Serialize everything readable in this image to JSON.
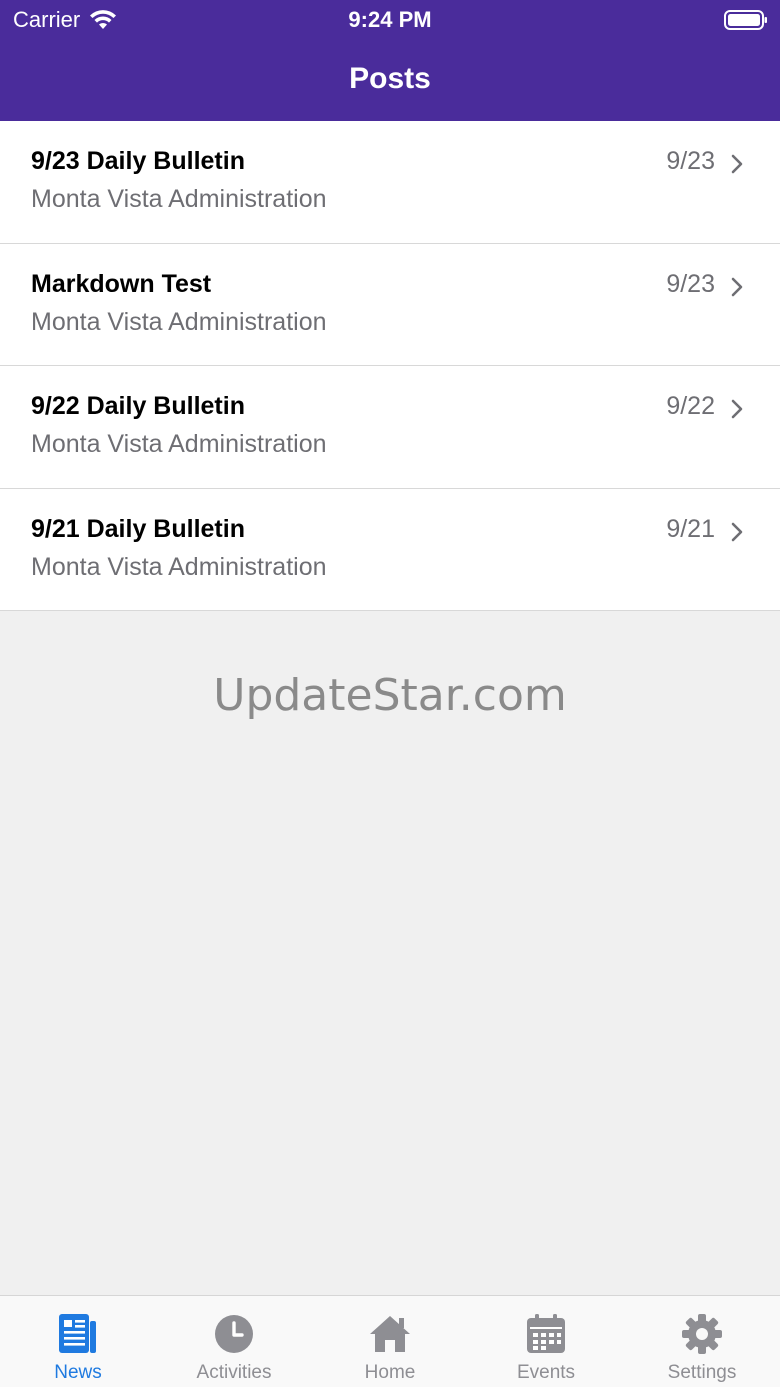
{
  "status_bar": {
    "carrier": "Carrier",
    "time": "9:24 PM"
  },
  "nav": {
    "title": "Posts"
  },
  "posts": [
    {
      "title": "9/23 Daily Bulletin",
      "author": "Monta Vista Administration",
      "date": "9/23"
    },
    {
      "title": "Markdown Test",
      "author": "Monta Vista Administration",
      "date": "9/23"
    },
    {
      "title": "9/22 Daily Bulletin",
      "author": "Monta Vista Administration",
      "date": "9/22"
    },
    {
      "title": "9/21 Daily Bulletin",
      "author": "Monta Vista Administration",
      "date": "9/21"
    }
  ],
  "watermark": "UpdateStar.com",
  "tabs": [
    {
      "label": "News",
      "icon": "newspaper-icon",
      "active": true
    },
    {
      "label": "Activities",
      "icon": "clock-icon",
      "active": false
    },
    {
      "label": "Home",
      "icon": "home-icon",
      "active": false
    },
    {
      "label": "Events",
      "icon": "calendar-icon",
      "active": false
    },
    {
      "label": "Settings",
      "icon": "gear-icon",
      "active": false
    }
  ],
  "colors": {
    "header": "#4a2c9b",
    "accent": "#1f7ae0",
    "inactive": "#8e8e93"
  }
}
